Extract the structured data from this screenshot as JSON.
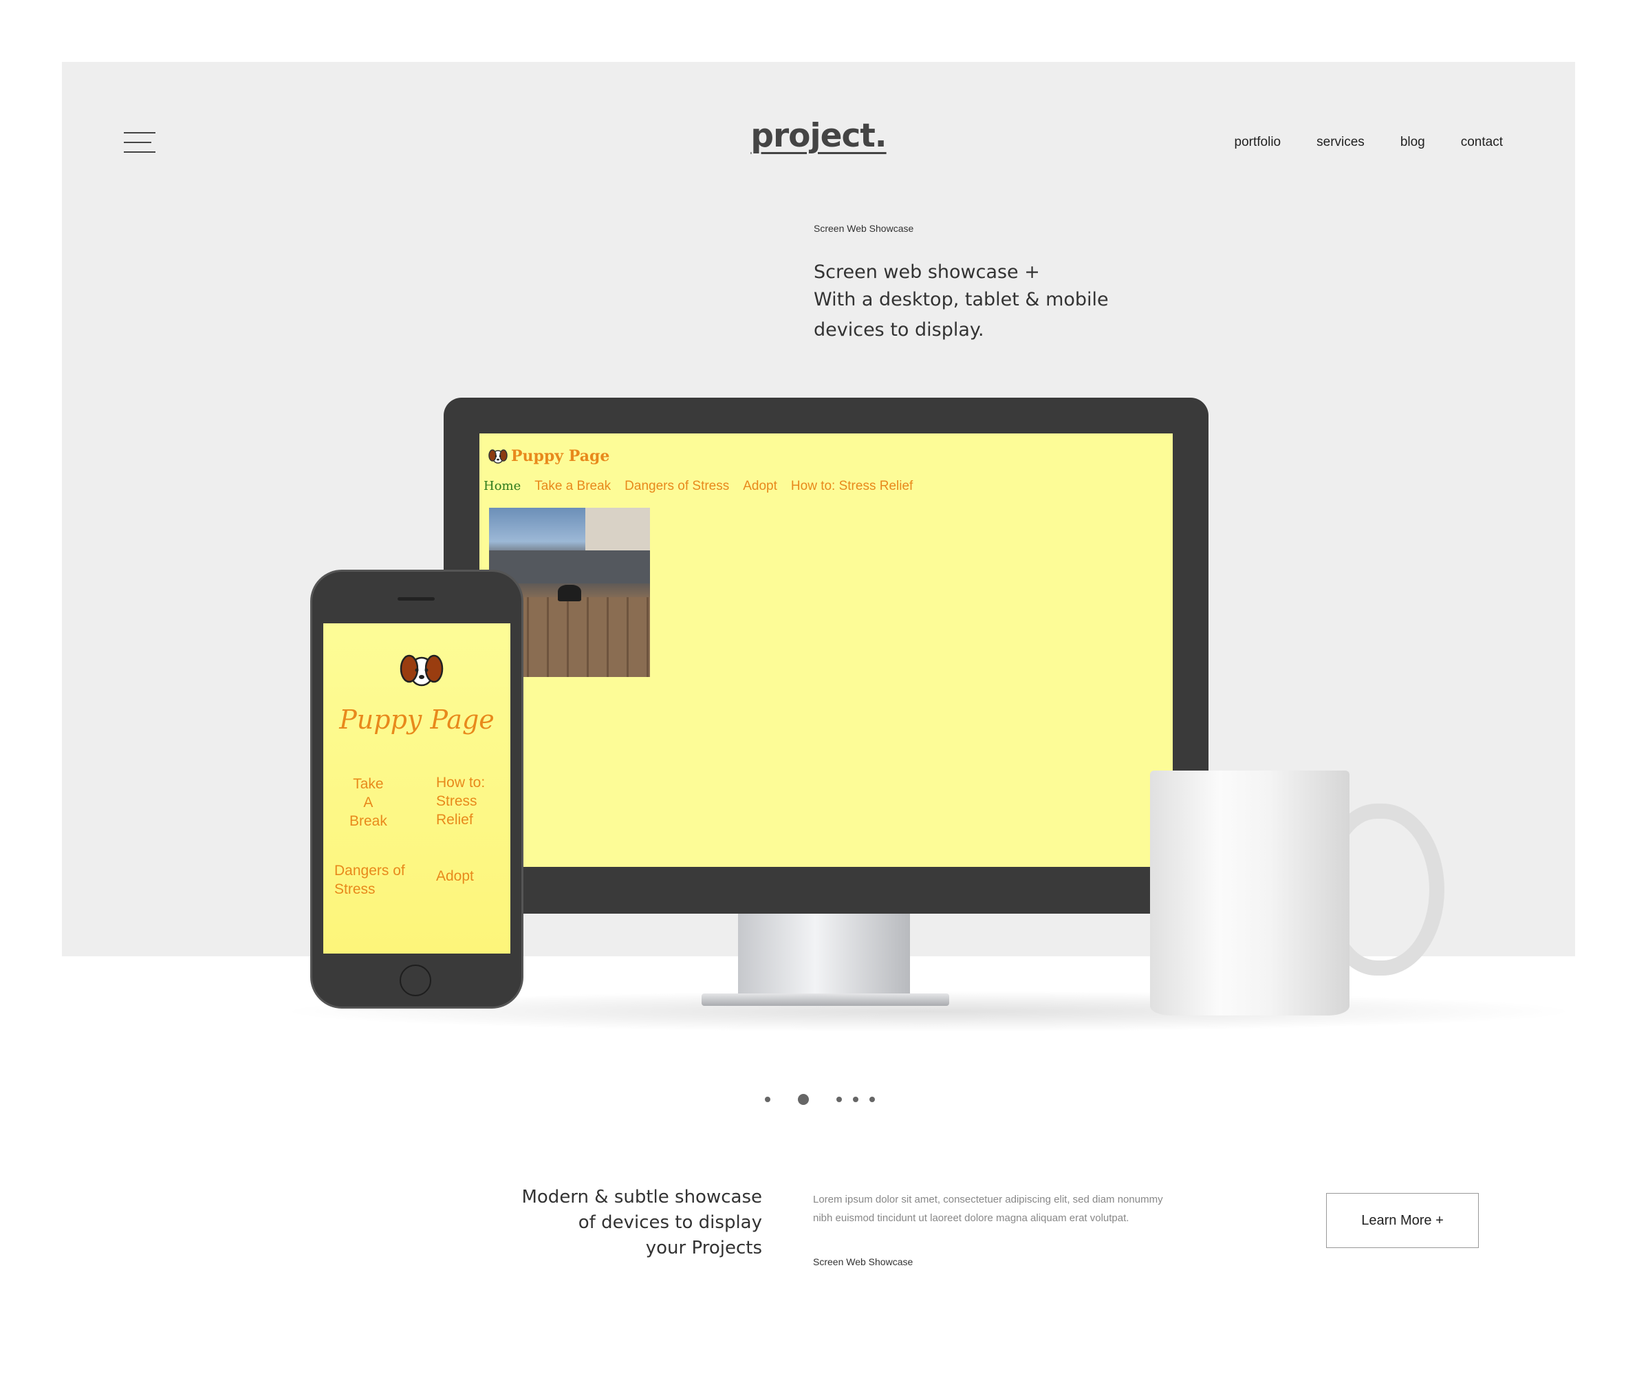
{
  "header": {
    "logo": "project.",
    "nav": [
      "portfolio",
      "services",
      "blog",
      "contact"
    ]
  },
  "hero": {
    "eyebrow": "Screen Web Showcase",
    "line1": "Screen web showcase +",
    "line2": "With a desktop, tablet & mobile",
    "line3": "devices to display."
  },
  "desktop_site": {
    "title": "Puppy Page",
    "nav": [
      "Home",
      "Take a Break",
      "Dangers of Stress",
      "Adopt",
      "How to: Stress Relief"
    ]
  },
  "mobile_site": {
    "title": "Puppy Page",
    "take_break_1": "Take",
    "take_break_2": "A",
    "take_break_3": "Break",
    "howto_1": "How to:",
    "howto_2": "Stress",
    "howto_3": "Relief",
    "dangers_1": "Dangers of",
    "dangers_2": "Stress",
    "adopt": "Adopt"
  },
  "pager": {
    "count": 5,
    "active_index": 1
  },
  "bottom": {
    "tagline_1": "Modern & subtle showcase",
    "tagline_2": "of devices to display",
    "tagline_3": "your Projects",
    "lorem_1": "Lorem ipsum dolor sit amet, consectetuer adipiscing elit, sed diam nonummy",
    "lorem_2": "nibh euismod tincidunt ut laoreet dolore magna aliquam erat volutpat.",
    "eyebrow": "Screen Web Showcase",
    "button": "Learn More +"
  },
  "colors": {
    "hero_bg": "#eeeeee",
    "screen_yellow": "#fdfc97",
    "site_orange": "#e8891c",
    "home_green": "#2c7a1c",
    "device_dark": "#3a3a3a"
  }
}
